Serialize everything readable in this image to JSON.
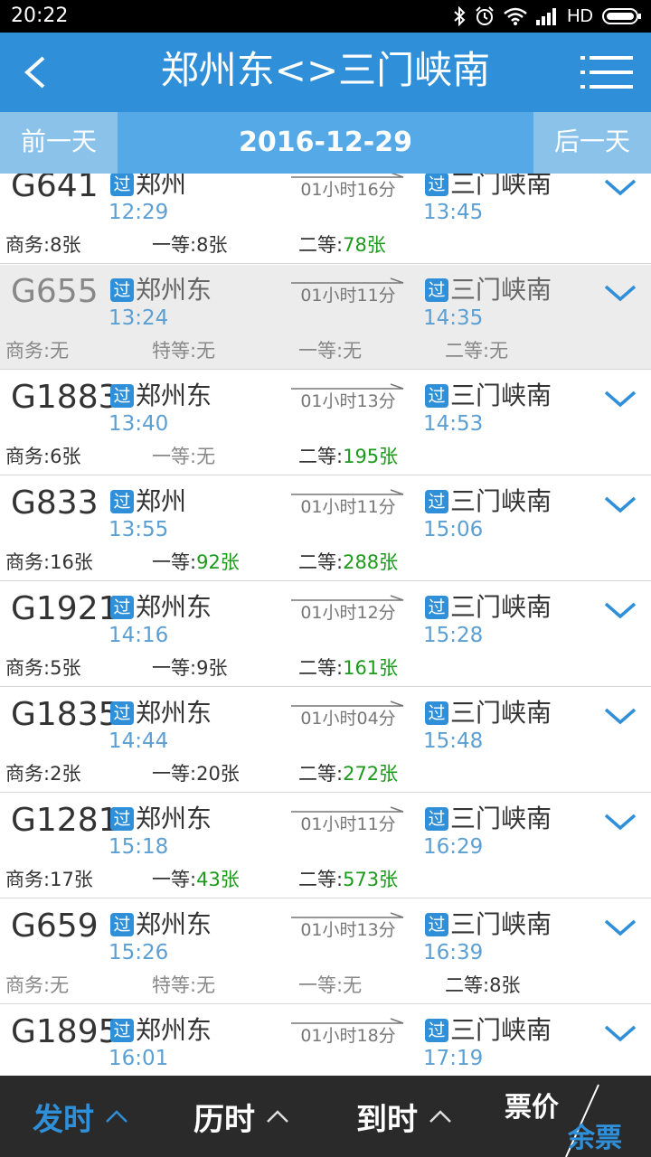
{
  "status": {
    "time": "20:22",
    "hd": "HD"
  },
  "header": {
    "title": "郑州东<>三门峡南"
  },
  "datebar": {
    "prev": "前一天",
    "date": "2016-12-29",
    "next": "后一天"
  },
  "trains": [
    {
      "no": "G641",
      "pass_tag": "过",
      "from": "郑州",
      "dep": "12:29",
      "duration": "01小时16分",
      "to": "三门峡南",
      "arr": "13:45",
      "dim": false,
      "seats": [
        {
          "label": "商务:",
          "value": "8张",
          "avail": true,
          "green": false
        },
        {
          "label": "一等:",
          "value": "8张",
          "avail": true,
          "green": false
        },
        {
          "label": "二等:",
          "value": "78张",
          "avail": true,
          "green": true
        }
      ]
    },
    {
      "no": "G655",
      "pass_tag": "过",
      "from": "郑州东",
      "dep": "13:24",
      "duration": "01小时11分",
      "to": "三门峡南",
      "arr": "14:35",
      "dim": true,
      "seats": [
        {
          "label": "商务:",
          "value": "无",
          "avail": false,
          "green": false
        },
        {
          "label": "特等:",
          "value": "无",
          "avail": false,
          "green": false
        },
        {
          "label": "一等:",
          "value": "无",
          "avail": false,
          "green": false
        },
        {
          "label": "二等:",
          "value": "无",
          "avail": false,
          "green": false
        }
      ]
    },
    {
      "no": "G1883",
      "pass_tag": "过",
      "from": "郑州东",
      "dep": "13:40",
      "duration": "01小时13分",
      "to": "三门峡南",
      "arr": "14:53",
      "dim": false,
      "seats": [
        {
          "label": "商务:",
          "value": "6张",
          "avail": true,
          "green": false
        },
        {
          "label": "一等:",
          "value": "无",
          "avail": false,
          "green": false
        },
        {
          "label": "二等:",
          "value": "195张",
          "avail": true,
          "green": true
        }
      ]
    },
    {
      "no": "G833",
      "pass_tag": "过",
      "from": "郑州",
      "dep": "13:55",
      "duration": "01小时11分",
      "to": "三门峡南",
      "arr": "15:06",
      "dim": false,
      "seats": [
        {
          "label": "商务:",
          "value": "16张",
          "avail": true,
          "green": false
        },
        {
          "label": "一等:",
          "value": "92张",
          "avail": true,
          "green": true
        },
        {
          "label": "二等:",
          "value": "288张",
          "avail": true,
          "green": true
        }
      ]
    },
    {
      "no": "G1921",
      "pass_tag": "过",
      "from": "郑州东",
      "dep": "14:16",
      "duration": "01小时12分",
      "to": "三门峡南",
      "arr": "15:28",
      "dim": false,
      "seats": [
        {
          "label": "商务:",
          "value": "5张",
          "avail": true,
          "green": false
        },
        {
          "label": "一等:",
          "value": "9张",
          "avail": true,
          "green": false
        },
        {
          "label": "二等:",
          "value": "161张",
          "avail": true,
          "green": true
        }
      ]
    },
    {
      "no": "G1835",
      "pass_tag": "过",
      "from": "郑州东",
      "dep": "14:44",
      "duration": "01小时04分",
      "to": "三门峡南",
      "arr": "15:48",
      "dim": false,
      "seats": [
        {
          "label": "商务:",
          "value": "2张",
          "avail": true,
          "green": false
        },
        {
          "label": "一等:",
          "value": "20张",
          "avail": true,
          "green": false
        },
        {
          "label": "二等:",
          "value": "272张",
          "avail": true,
          "green": true
        }
      ]
    },
    {
      "no": "G1281",
      "pass_tag": "过",
      "from": "郑州东",
      "dep": "15:18",
      "duration": "01小时11分",
      "to": "三门峡南",
      "arr": "16:29",
      "dim": false,
      "seats": [
        {
          "label": "商务:",
          "value": "17张",
          "avail": true,
          "green": false
        },
        {
          "label": "一等:",
          "value": "43张",
          "avail": true,
          "green": true
        },
        {
          "label": "二等:",
          "value": "573张",
          "avail": true,
          "green": true
        }
      ]
    },
    {
      "no": "G659",
      "pass_tag": "过",
      "from": "郑州东",
      "dep": "15:26",
      "duration": "01小时13分",
      "to": "三门峡南",
      "arr": "16:39",
      "dim": false,
      "seats": [
        {
          "label": "商务:",
          "value": "无",
          "avail": false,
          "green": false
        },
        {
          "label": "特等:",
          "value": "无",
          "avail": false,
          "green": false
        },
        {
          "label": "一等:",
          "value": "无",
          "avail": false,
          "green": false
        },
        {
          "label": "二等:",
          "value": "8张",
          "avail": true,
          "green": false
        }
      ]
    },
    {
      "no": "G1895",
      "pass_tag": "过",
      "from": "郑州东",
      "dep": "16:01",
      "duration": "01小时18分",
      "to": "三门峡南",
      "arr": "17:19",
      "dim": false,
      "seats": []
    }
  ],
  "bottom": {
    "depart": "发时",
    "duration": "历时",
    "arrive": "到时",
    "price": "票价",
    "remain": "余票"
  },
  "colors": {
    "primary": "#2f8fd8",
    "available": "#1b9a1b",
    "header_bg": "#2f8fd8",
    "datebar_bg": "#55a9e6"
  }
}
